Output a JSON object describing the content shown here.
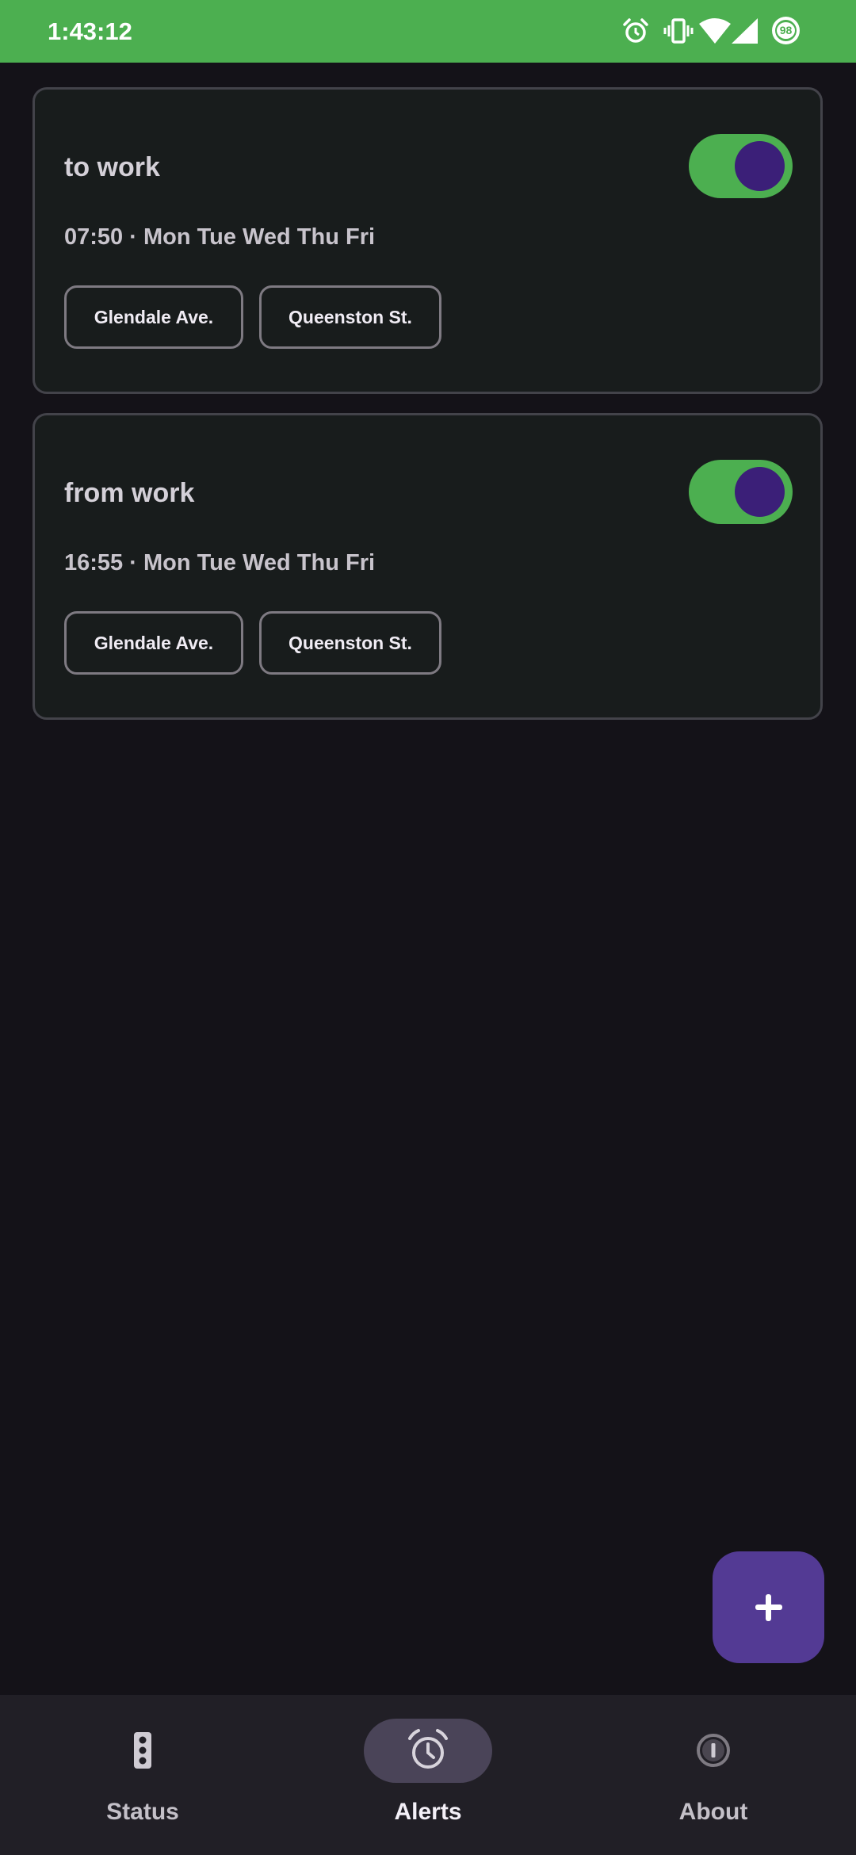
{
  "status_bar": {
    "time": "1:43:12",
    "battery_level": "98",
    "icons": [
      "alarm-icon",
      "vibrate-icon",
      "wifi-icon",
      "signal-icon",
      "battery-icon"
    ],
    "color": "#4caf50"
  },
  "alerts": [
    {
      "name": "to work",
      "schedule": "07:50 · Mon Tue Wed Thu Fri",
      "enabled": true,
      "stops": [
        "Glendale Ave.",
        "Queenston St."
      ]
    },
    {
      "name": "from work",
      "schedule": "16:55 · Mon Tue Wed Thu Fri",
      "enabled": true,
      "stops": [
        "Glendale Ave.",
        "Queenston St."
      ]
    }
  ],
  "fab": {
    "icon": "plus-icon",
    "color": "#533a94"
  },
  "bottom_nav": {
    "items": [
      {
        "label": "Status",
        "icon": "traffic-light-icon",
        "active": false
      },
      {
        "label": "Alerts",
        "icon": "alarm-icon",
        "active": true
      },
      {
        "label": "About",
        "icon": "info-icon",
        "active": false
      }
    ]
  },
  "colors": {
    "background": "#141218",
    "card": "#181c1c",
    "toggle_track": "#4caf50",
    "toggle_thumb": "#3b1f78"
  }
}
